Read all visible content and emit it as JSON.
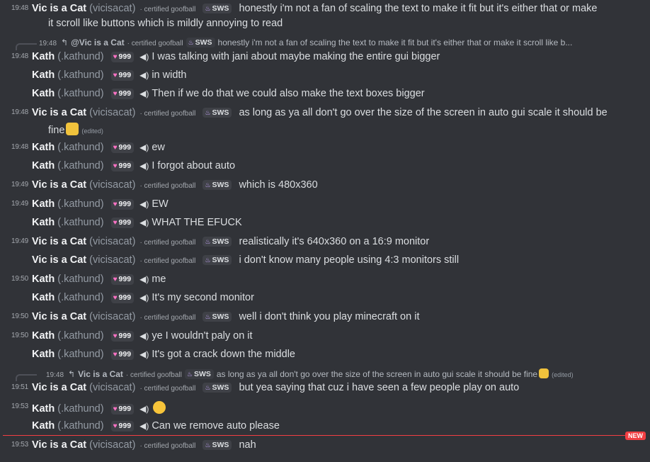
{
  "users": {
    "vic": {
      "name": "Vic is a Cat",
      "handle": "(vicisacat)",
      "tag": "· certified goofball",
      "badge": "SWS"
    },
    "kath": {
      "name": "Kath",
      "handle": "(.kathund)",
      "badge": "999"
    }
  },
  "messages": [
    {
      "time": "19:48",
      "text": "honestly i'm not a fan of scaling the text to make it fit but it's either that or make",
      "text2": "it scroll like buttons which is mildly annoying to read"
    },
    {
      "reply_time": "19:48",
      "reply_name": "@Vic is a Cat",
      "reply_tag": "· certified goofball",
      "reply_text": "honestly i'm not a fan of scaling the text to make it fit but it's either that or make it scroll like b..."
    },
    {
      "time": "19:48",
      "text": "I was talking with jani about maybe making the entire gui bigger"
    },
    {
      "text": "in width"
    },
    {
      "text": "Then if we do that we could also make the text boxes bigger"
    },
    {
      "time": "19:48",
      "text": "as long as ya all don't go over the size of the screen in auto gui scale it should be",
      "text2": "fine",
      "edited": "(edited)"
    },
    {
      "time": "19:48",
      "text": "ew"
    },
    {
      "text": "I forgot about auto"
    },
    {
      "time": "19:49",
      "text": "which is 480x360"
    },
    {
      "time": "19:49",
      "text": "EW"
    },
    {
      "text": "WHAT THE EFUCK"
    },
    {
      "time": "19:49",
      "text": "realistically it's 640x360 on a 16:9 monitor"
    },
    {
      "text": "i don't know many people using 4:3 monitors still"
    },
    {
      "time": "19:50",
      "text": "me"
    },
    {
      "text": "It's my second monitor"
    },
    {
      "time": "19:50",
      "text": "well i don't think you play minecraft on it"
    },
    {
      "time": "19:50",
      "text": "ye I wouldn't paly on it"
    },
    {
      "text": "It's got a crack down the middle"
    },
    {
      "reply_time": "19:48",
      "reply_name": "Vic is a Cat",
      "reply_tag": "· certified goofball",
      "reply_text": "as long as ya all don't go over the size of the screen in auto gui scale it should be fine",
      "edited": "(edited)"
    },
    {
      "time": "19:51",
      "text": "but yea saying that cuz i have seen a few people play on auto"
    },
    {
      "time": "19:53",
      "text": ""
    },
    {
      "text": "Can we remove auto please"
    },
    {
      "time": "19:53",
      "text": "nah"
    }
  ],
  "new_label": "NEW",
  "icons": {
    "speaker": "speaker-icon",
    "reply": "reply-arrow-icon",
    "heart": "heart-icon",
    "fire": "flame-icon"
  }
}
